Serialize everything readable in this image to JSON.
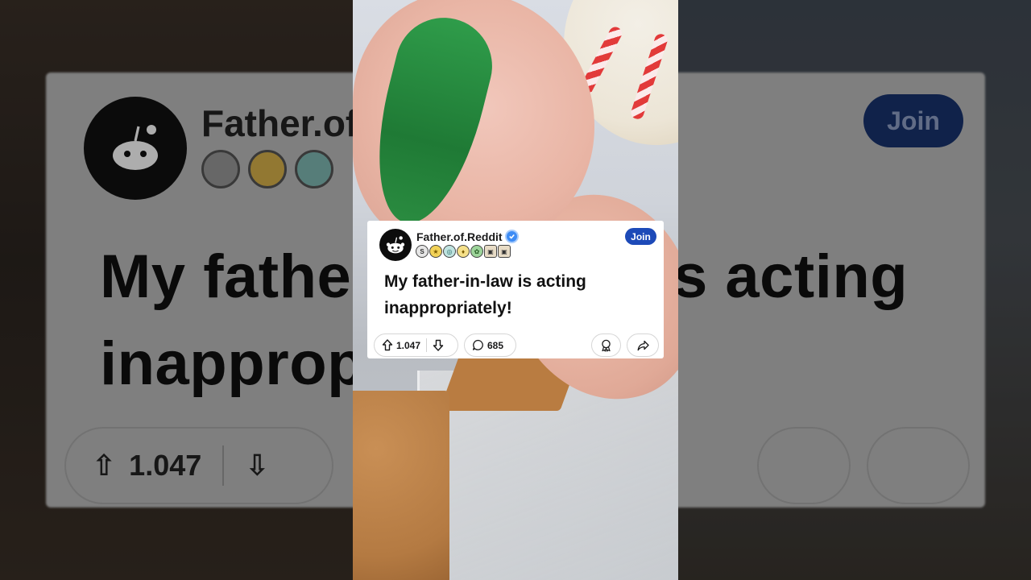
{
  "post": {
    "author": "Father.of.Reddit",
    "join_label": "Join",
    "title": "My father-in-law is acting inappropriately!",
    "upvotes": "1.047",
    "comments": "685",
    "badges": [
      "S",
      "★",
      "◎",
      "♦",
      "✿",
      "▣",
      "▣"
    ]
  },
  "background": {
    "author": "Father.of",
    "title_line1": "My fathe",
    "title_line1_right": "s acting",
    "title_line2": "inapprop",
    "upvotes": "1.047",
    "join_label": "Join"
  },
  "icons": {
    "avatar": "reddit-snoo-icon",
    "verified": "verified-check-icon",
    "upvote": "arrow-up-icon",
    "downvote": "arrow-down-icon",
    "comments": "comment-bubble-icon",
    "award": "award-ribbon-icon",
    "share": "share-arrow-icon"
  },
  "colors": {
    "join_button": "#1d4ab8",
    "verified": "#3d8cf5",
    "card_background": "#ffffff",
    "icing_bag": "#2f9c4a"
  }
}
